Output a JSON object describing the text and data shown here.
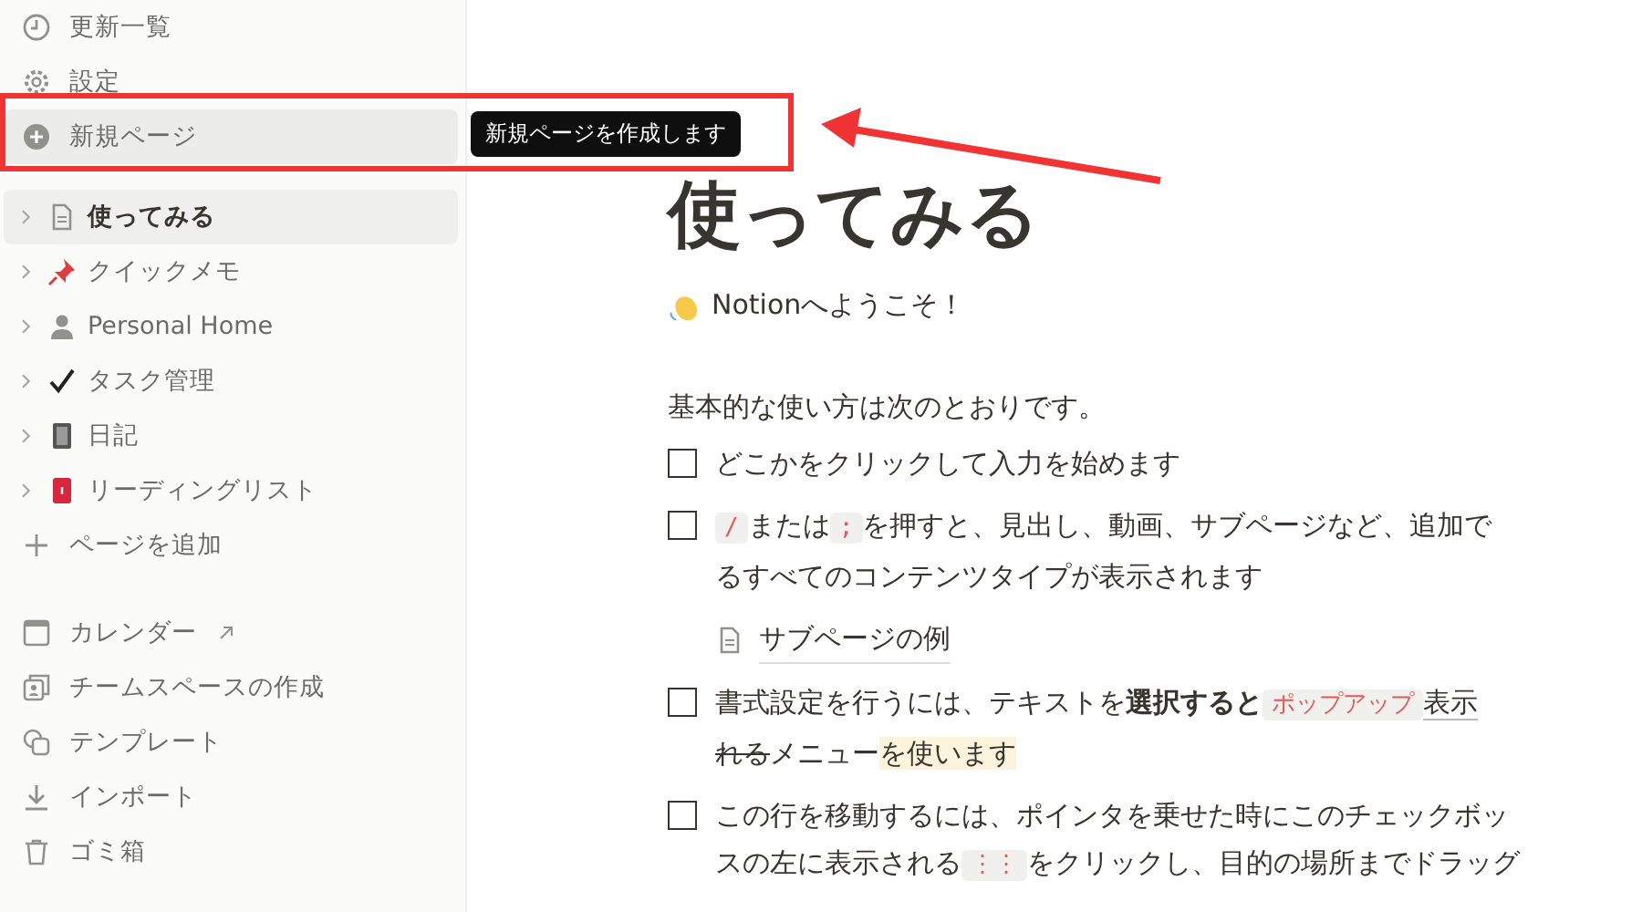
{
  "sidebar": {
    "top_items": [
      {
        "label": "更新一覧",
        "hovered": false
      },
      {
        "label": "設定",
        "hovered": false
      },
      {
        "label": "新規ページ",
        "hovered": true
      }
    ],
    "pages": [
      {
        "label": "使ってみる",
        "selected": true
      },
      {
        "label": "クイックメモ",
        "selected": false
      },
      {
        "label": "Personal Home",
        "selected": false
      },
      {
        "label": "タスク管理",
        "selected": false
      },
      {
        "label": "日記",
        "selected": false
      },
      {
        "label": "リーディングリスト",
        "selected": false
      }
    ],
    "add_page": "ページを追加",
    "bottom_items": [
      {
        "label": "カレンダー",
        "external": true
      },
      {
        "label": "チームスペースの作成",
        "external": false
      },
      {
        "label": "テンプレート",
        "external": false
      },
      {
        "label": "インポート",
        "external": false
      },
      {
        "label": "ゴミ箱",
        "external": false
      }
    ]
  },
  "tooltip": "新規ページを作成します",
  "page": {
    "title": "使ってみる",
    "welcome": "Notionへようこそ！",
    "intro": "基本的な使い方は次のとおりです。",
    "blocks": [
      {
        "kind": "todo",
        "checked": false,
        "lines": [
          [
            {
              "kind": "plain",
              "text": "どこかをクリックして入力を始めます"
            }
          ]
        ]
      },
      {
        "kind": "todo",
        "checked": false,
        "lines": [
          [
            {
              "kind": "code",
              "text": "/"
            },
            {
              "kind": "plain",
              "text": "または"
            },
            {
              "kind": "code",
              "text": ";"
            },
            {
              "kind": "plain",
              "text": "を押すと、見出し、動画、サブページなど、追加で"
            }
          ],
          [
            {
              "kind": "plain",
              "text": "るすべてのコンテンツタイプが表示されます"
            }
          ]
        ]
      },
      {
        "kind": "subpage",
        "label": "サブページの例"
      },
      {
        "kind": "todo",
        "checked": false,
        "lines": [
          [
            {
              "kind": "plain",
              "text": "書式設定を行うには、テキストを"
            },
            {
              "kind": "bold",
              "text": "選択すると"
            },
            {
              "kind": "code",
              "text": "ポップアップ"
            },
            {
              "kind": "underline",
              "text": "表示"
            }
          ],
          [
            {
              "kind": "strike",
              "text": "れる"
            },
            {
              "kind": "plain",
              "text": "メニュー"
            },
            {
              "kind": "highlight",
              "text": "を使います"
            }
          ]
        ]
      },
      {
        "kind": "todo",
        "checked": false,
        "lines": [
          [
            {
              "kind": "plain",
              "text": "この行を移動するには、ポインタを乗せた時にこのチェックボッ"
            }
          ],
          [
            {
              "kind": "plain",
              "text": "スの左に表示される"
            },
            {
              "kind": "code",
              "text": "⋮⋮"
            },
            {
              "kind": "plain",
              "text": "をクリックし、目的の場所までドラッグ"
            }
          ]
        ]
      }
    ]
  }
}
